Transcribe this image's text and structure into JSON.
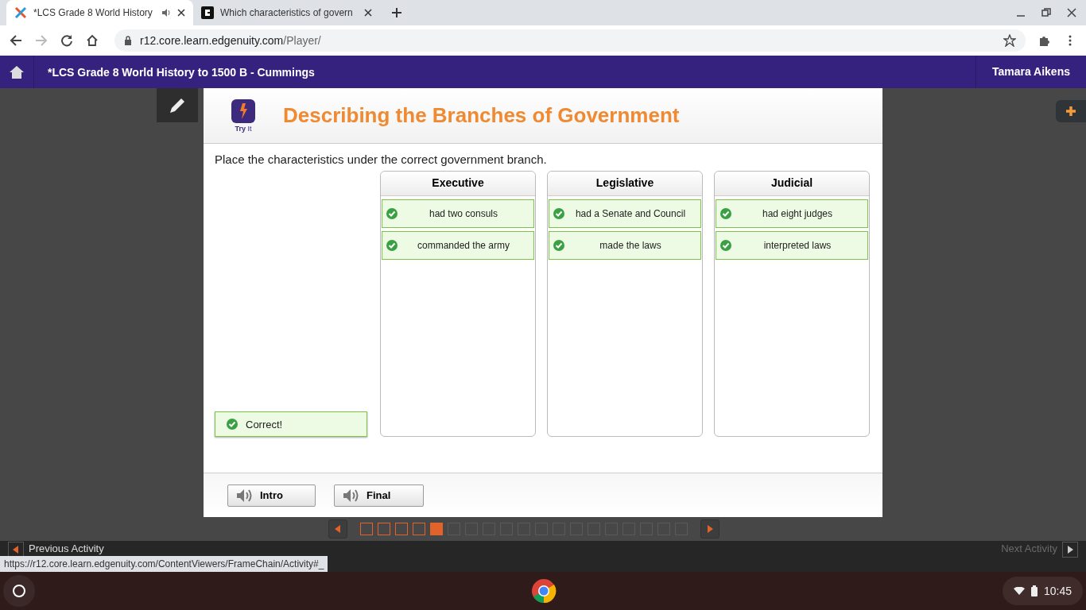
{
  "browser": {
    "tabs": [
      {
        "title": "*LCS Grade 8 World History",
        "selected": true,
        "audio": true
      },
      {
        "title": "Which characteristics of govern",
        "selected": false,
        "audio": false
      }
    ],
    "url_host": "r12.core.learn.edgenuity.com",
    "url_path": "/Player/"
  },
  "header": {
    "course": "*LCS Grade 8 World History to 1500 B - Cummings",
    "user": "Tamara Aikens"
  },
  "activity": {
    "badge": "**Try** It",
    "title": "Describing the Branches of Government",
    "instruction": "Place the characteristics under the correct government branch.",
    "feedback": {
      "text": "Correct!",
      "correct": true
    },
    "columns": [
      {
        "heading": "Executive",
        "items": [
          {
            "text": "had two consuls",
            "correct": true
          },
          {
            "text": "commanded the army",
            "correct": true
          }
        ]
      },
      {
        "heading": "Legislative",
        "items": [
          {
            "text": "had a Senate and Council",
            "correct": true
          },
          {
            "text": "made the laws",
            "correct": true
          }
        ]
      },
      {
        "heading": "Judicial",
        "items": [
          {
            "text": "had eight judges",
            "correct": true
          },
          {
            "text": "interpreted laws",
            "correct": true
          }
        ]
      }
    ],
    "buttons": [
      "Intro",
      "Final"
    ]
  },
  "pager": [
    {
      "visited": true,
      "selected": false
    },
    {
      "visited": true,
      "selected": false
    },
    {
      "visited": true,
      "selected": false
    },
    {
      "visited": true,
      "selected": false
    },
    {
      "visited": true,
      "selected": true
    },
    {
      "visited": false,
      "selected": false
    },
    {
      "visited": false,
      "selected": false
    },
    {
      "visited": false,
      "selected": false
    },
    {
      "visited": false,
      "selected": false
    },
    {
      "visited": false,
      "selected": false
    },
    {
      "visited": false,
      "selected": false
    },
    {
      "visited": false,
      "selected": false
    },
    {
      "visited": false,
      "selected": false
    },
    {
      "visited": false,
      "selected": false
    },
    {
      "visited": false,
      "selected": false
    },
    {
      "visited": false,
      "selected": false
    },
    {
      "visited": false,
      "selected": false
    },
    {
      "visited": false,
      "selected": false
    },
    {
      "visited": false,
      "selected": false
    }
  ],
  "activity_nav": {
    "previous": "Previous Activity",
    "next": "Next Activity"
  },
  "status_url": "https://r12.core.learn.edgenuity.com/ContentViewers/FrameChain/Activity#_",
  "shelf": {
    "time": "10:45"
  }
}
